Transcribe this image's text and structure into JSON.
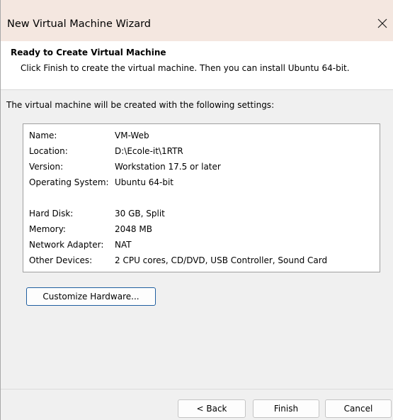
{
  "window": {
    "title": "New Virtual Machine Wizard"
  },
  "header": {
    "title": "Ready to Create Virtual Machine",
    "subtitle": "Click Finish to create the virtual machine. Then you can install Ubuntu 64-bit."
  },
  "intro": "The virtual machine will be created with the following settings:",
  "settings": [
    {
      "label": "Name:",
      "value": "VM-Web"
    },
    {
      "label": "Location:",
      "value": "D:\\Ecole-it\\1RTR"
    },
    {
      "label": "Version:",
      "value": "Workstation 17.5 or later"
    },
    {
      "label": "Operating System:",
      "value": "Ubuntu 64-bit"
    },
    {
      "label": "Hard Disk:",
      "value": "30 GB, Split"
    },
    {
      "label": "Memory:",
      "value": "2048 MB"
    },
    {
      "label": "Network Adapter:",
      "value": "NAT"
    },
    {
      "label": "Other Devices:",
      "value": "2 CPU cores, CD/DVD, USB Controller, Sound Card"
    }
  ],
  "buttons": {
    "customize": "Customize Hardware...",
    "back": "< Back",
    "finish": "Finish",
    "cancel": "Cancel"
  },
  "icons": {
    "close": "close-icon"
  },
  "colors": {
    "titlebar": "#f4e7e0",
    "dialog_bg": "#f0f0f0",
    "focus_border": "#1f5e9f"
  }
}
